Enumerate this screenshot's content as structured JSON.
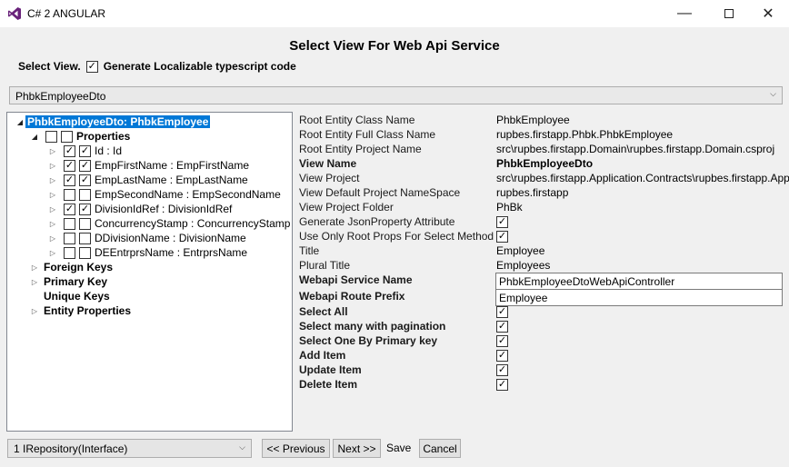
{
  "window": {
    "title": "C# 2 ANGULAR"
  },
  "heading": "Select View For Web Api Service",
  "select_view": {
    "label": "Select View.",
    "checkbox_label": "Generate Localizable typescript code",
    "checked": true
  },
  "view_dropdown": {
    "value": "PhbkEmployeeDto"
  },
  "tree": {
    "root": "PhbkEmployeeDto: PhbkEmployee",
    "properties_label": "Properties",
    "items": [
      {
        "label": "Id : Id",
        "checked": true
      },
      {
        "label": "EmpFirstName : EmpFirstName",
        "checked": true
      },
      {
        "label": "EmpLastName : EmpLastName",
        "checked": true
      },
      {
        "label": "EmpSecondName : EmpSecondName",
        "checked": false
      },
      {
        "label": "DivisionIdRef : DivisionIdRef",
        "checked": true
      },
      {
        "label": "ConcurrencyStamp : ConcurrencyStamp",
        "checked": false
      },
      {
        "label": "DDivisionName : DivisionName",
        "checked": false
      },
      {
        "label": "DEEntrprsName : EntrprsName",
        "checked": false
      }
    ],
    "groups": [
      "Foreign Keys",
      "Primary Key",
      "Unique Keys",
      "Entity Properties"
    ]
  },
  "props": {
    "root_entity_class_name": {
      "label": "Root Entity Class Name",
      "value": "PhbkEmployee"
    },
    "root_entity_full_class_name": {
      "label": "Root Entity Full Class Name",
      "value": "rupbes.firstapp.Phbk.PhbkEmployee"
    },
    "root_entity_project_name": {
      "label": "Root Entity Project Name",
      "value": "src\\rupbes.firstapp.Domain\\rupbes.firstapp.Domain.csproj"
    },
    "view_name": {
      "label": "View Name",
      "value": "PhbkEmployeeDto"
    },
    "view_project": {
      "label": "View Project",
      "value": "src\\rupbes.firstapp.Application.Contracts\\rupbes.firstapp.App"
    },
    "view_default_namespace": {
      "label": "View Default Project NameSpace",
      "value": "rupbes.firstapp"
    },
    "view_project_folder": {
      "label": "View Project Folder",
      "value": "PhBk"
    },
    "generate_jsonproperty": {
      "label": "Generate JsonProperty Attribute",
      "checked": true
    },
    "use_only_root_props": {
      "label": "Use Only Root Props For Select Method",
      "checked": true
    },
    "title": {
      "label": "Title",
      "value": "Employee"
    },
    "plural_title": {
      "label": "Plural Title",
      "value": "Employees"
    },
    "webapi_service_name": {
      "label": "Webapi Service Name",
      "value": "PhbkEmployeeDtoWebApiController"
    },
    "webapi_route_prefix": {
      "label": "Webapi Route Prefix",
      "value": "Employee"
    },
    "select_all": {
      "label": "Select All",
      "checked": true
    },
    "select_many": {
      "label": "Select many with pagination",
      "checked": true
    },
    "select_one": {
      "label": "Select One By Primary key",
      "checked": true
    },
    "add_item": {
      "label": "Add Item",
      "checked": true
    },
    "update_item": {
      "label": "Update Item",
      "checked": true
    },
    "delete_item": {
      "label": "Delete Item",
      "checked": true
    }
  },
  "footer": {
    "repository_dropdown": "1 IRepository(Interface)",
    "previous_label": "<< Previous",
    "next_label": "Next >>",
    "save_label": "Save",
    "cancel_label": "Cancel"
  },
  "colors": {
    "selection": "#0078d7",
    "vs_purple": "#68217a"
  }
}
